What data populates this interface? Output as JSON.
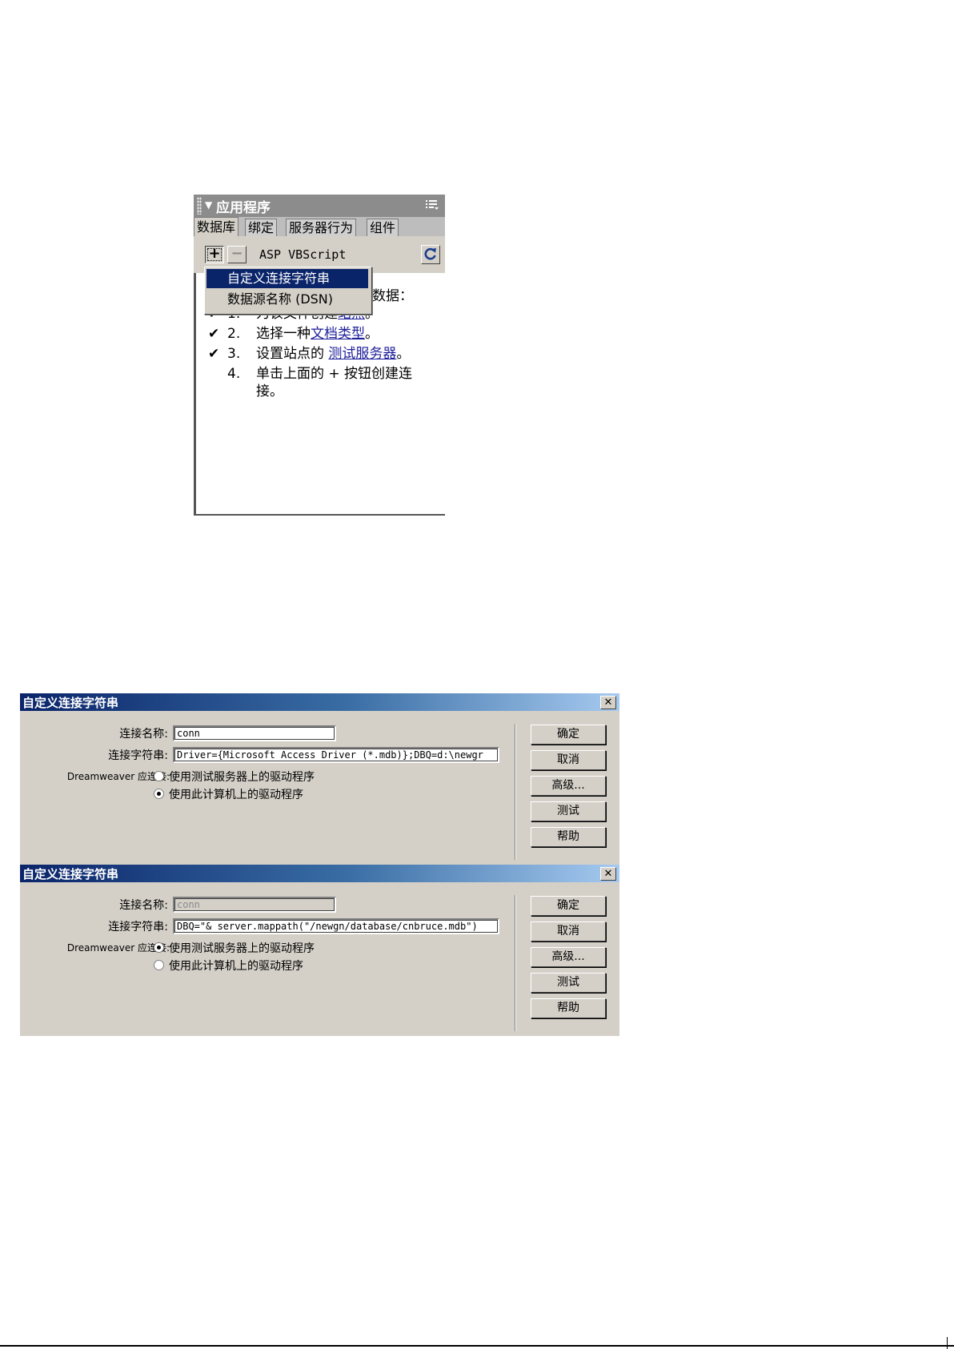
{
  "panel": {
    "title": "应用程序",
    "tabs": [
      "数据库",
      "绑定",
      "服务器行为",
      "组件"
    ],
    "toolbar": {
      "add": "+",
      "remove": "−",
      "document_type": "ASP VBScript"
    },
    "intro": "数据：",
    "steps": [
      {
        "check": "✔",
        "num": "1.",
        "text": "为该文件创建",
        "link": "站点",
        "end": "。"
      },
      {
        "check": "✔",
        "num": "2.",
        "text": "选择一种",
        "link": "文档类型",
        "end": "。"
      },
      {
        "check": "✔",
        "num": "3.",
        "text": "设置站点的 ",
        "link": "测试服务器",
        "end": "。"
      },
      {
        "check": "",
        "num": "4.",
        "text": "单击上面的 + 按钮创建连",
        "cont": "接。"
      }
    ],
    "menu": [
      "自定义连接字符串",
      "数据源名称 (DSN)"
    ]
  },
  "dialogs": [
    {
      "title": "自定义连接字符串",
      "name_label": "连接名称:",
      "name_value": "conn",
      "string_label": "连接字符串:",
      "string_value": "Driver={Microsoft Access Driver (*.mdb)};DBQ=d:\\newgr",
      "connect_label": "Dreamweaver 应连接:",
      "radio1": "使用测试服务器上的驱动程序",
      "radio2": "使用此计算机上的驱动程序",
      "selected": 2,
      "buttons": [
        "确定",
        "取消",
        "高级...",
        "测试",
        "帮助"
      ]
    },
    {
      "title": "自定义连接字符串",
      "name_label": "连接名称:",
      "name_value": "conn",
      "string_label": "连接字符串:",
      "string_value": "DBQ=\"& server.mappath(\"/newgn/database/cnbruce.mdb\")",
      "connect_label": "Dreamweaver 应连接:",
      "radio1": "使用测试服务器上的驱动程序",
      "radio2": "使用此计算机上的驱动程序",
      "selected": 1,
      "buttons": [
        "确定",
        "取消",
        "高级...",
        "测试",
        "帮助"
      ]
    }
  ]
}
